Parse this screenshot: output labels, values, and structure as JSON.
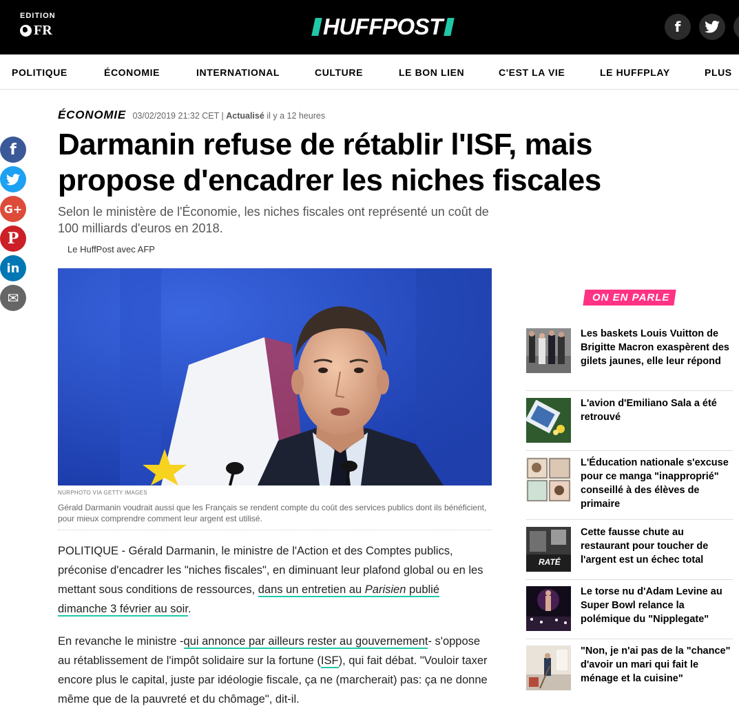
{
  "header": {
    "edition_label": "EDITION",
    "edition_code": "FR",
    "logo_text": "HUFFPOST"
  },
  "nav": {
    "items": [
      {
        "label": "POLITIQUE"
      },
      {
        "label": "ÉCONOMIE"
      },
      {
        "label": "INTERNATIONAL"
      },
      {
        "label": "CULTURE"
      },
      {
        "label": "LE BON LIEN"
      },
      {
        "label": "C'EST LA VIE"
      },
      {
        "label": "LE HUFFPLAY"
      },
      {
        "label": "PLUS"
      }
    ]
  },
  "share": {
    "buttons": [
      {
        "icon": "facebook-icon",
        "glyph": "f",
        "color": "#3b5998"
      },
      {
        "icon": "twitter-icon",
        "glyph": "🐦",
        "color": "#1da1f2"
      },
      {
        "icon": "google-plus-icon",
        "glyph": "G+",
        "color": "#dd4b39"
      },
      {
        "icon": "pinterest-icon",
        "glyph": "P",
        "color": "#cb2027"
      },
      {
        "icon": "linkedin-icon",
        "glyph": "in",
        "color": "#0077b5"
      },
      {
        "icon": "email-icon",
        "glyph": "✉",
        "color": "#666666"
      }
    ]
  },
  "article": {
    "section": "ÉCONOMIE",
    "date": "03/02/2019 21:32 CET",
    "separator": "|",
    "updated_label": "Actualisé",
    "updated_ago": "il y a 12 heures",
    "headline": "Darmanin refuse de rétablir l'ISF, mais propose d'encadrer les niches fiscales",
    "dek": "Selon le ministère de l'Économie, les niches fiscales ont représenté un coût de 100 milliards d'euros en 2018.",
    "byline": "Le HuffPost avec AFP",
    "image_credit": "NURPHOTO VIA GETTY IMAGES",
    "caption": "Gérald Darmanin voudrait aussi que les Français se rendent compte du coût des services publics dont ils bénéficient, pour mieux comprendre comment leur argent est utilisé.",
    "p1_a": "POLITIQUE - Gérald Darmanin, le ministre de l'Action et des Comptes publics, préconise d'encadrer les \"niches fiscales\", en diminuant leur plafond global ou en les mettant sous conditions de ressources, ",
    "p1_link_a": "dans un entretien au ",
    "p1_link_em": "Parisien",
    "p1_link_b": " publié dimanche 3 février au soir",
    "p1_end": ".",
    "p2_a": "En revanche le ministre -",
    "p2_link": "qui annonce par ailleurs rester au gouvernement",
    "p2_b": "- s'oppose au rétablissement de l'impôt solidaire sur la fortune (",
    "p2_link2": "ISF",
    "p2_c": "), qui fait débat. \"Vouloir taxer encore plus le capital, juste par idéologie fiscale, ça ne (marcherait) pas: ça ne donne même que de la pauvreté et du chômage\", dit-il."
  },
  "rail": {
    "heading": "ON EN PARLE",
    "items": [
      {
        "title": "Les baskets Louis Vuitton de Brigitte Macron exaspèrent des gilets jaunes, elle leur répond"
      },
      {
        "title": "L'avion d'Emiliano Sala a été retrouvé"
      },
      {
        "title": "L'Éducation nationale s'excuse pour ce manga \"inapproprié\" conseillé à des élèves de primaire"
      },
      {
        "title": "Cette fausse chute au restaurant pour toucher de l'argent est un échec total",
        "badge": "RATÉ"
      },
      {
        "title": "Le torse nu d'Adam Levine au Super Bowl relance la polémique du \"Nipplegate\""
      },
      {
        "title": "\"Non, je n'ai pas de la \"chance\" d'avoir un mari qui fait le ménage et la cuisine\""
      }
    ]
  }
}
